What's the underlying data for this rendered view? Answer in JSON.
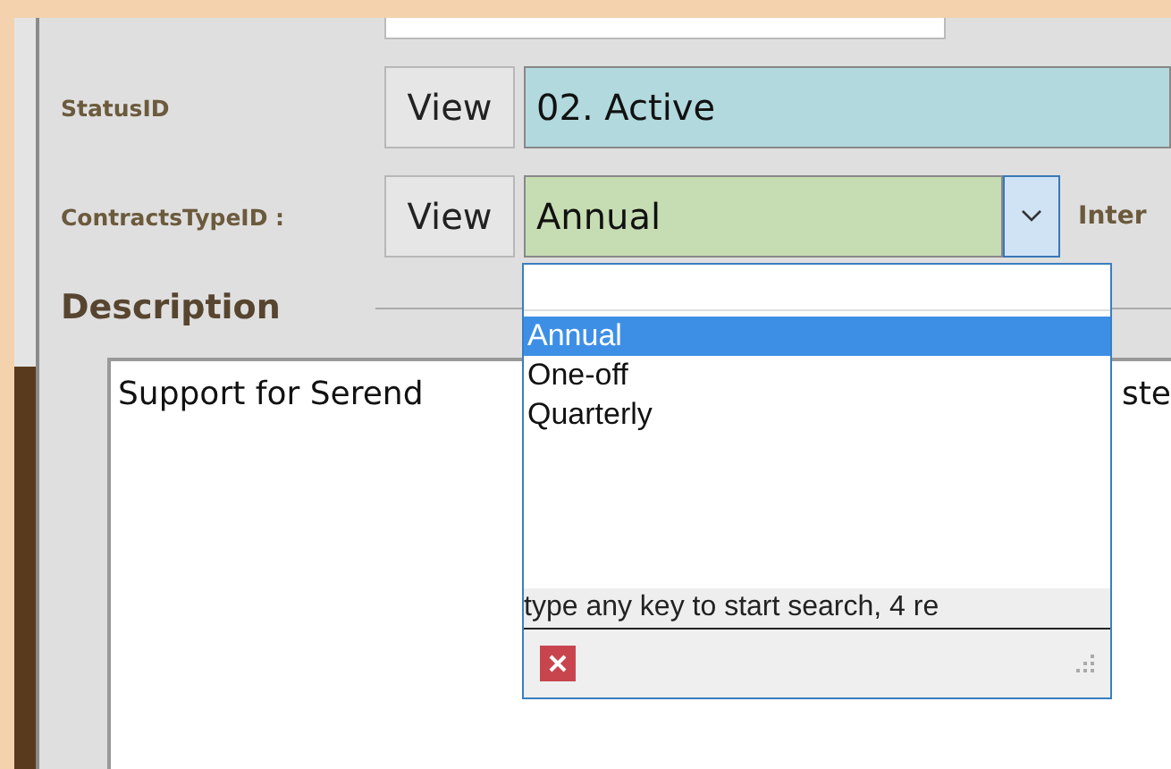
{
  "rows": [
    {
      "label": "StatusID",
      "view_button": "View",
      "value": "02. Active",
      "kind": "text"
    },
    {
      "label": "ContractsTypeID :",
      "view_button": "View",
      "value": "Annual",
      "kind": "combo",
      "trailing_label": "Inter"
    }
  ],
  "description": {
    "heading": "Description",
    "text_visible_left": "Support for Serend",
    "text_visible_right": "ste"
  },
  "dropdown": {
    "items": [
      {
        "label": "Annual",
        "selected": true
      },
      {
        "label": "One-off",
        "selected": false
      },
      {
        "label": "Quarterly",
        "selected": false
      }
    ],
    "status": "type any key to start search, 4 re"
  }
}
